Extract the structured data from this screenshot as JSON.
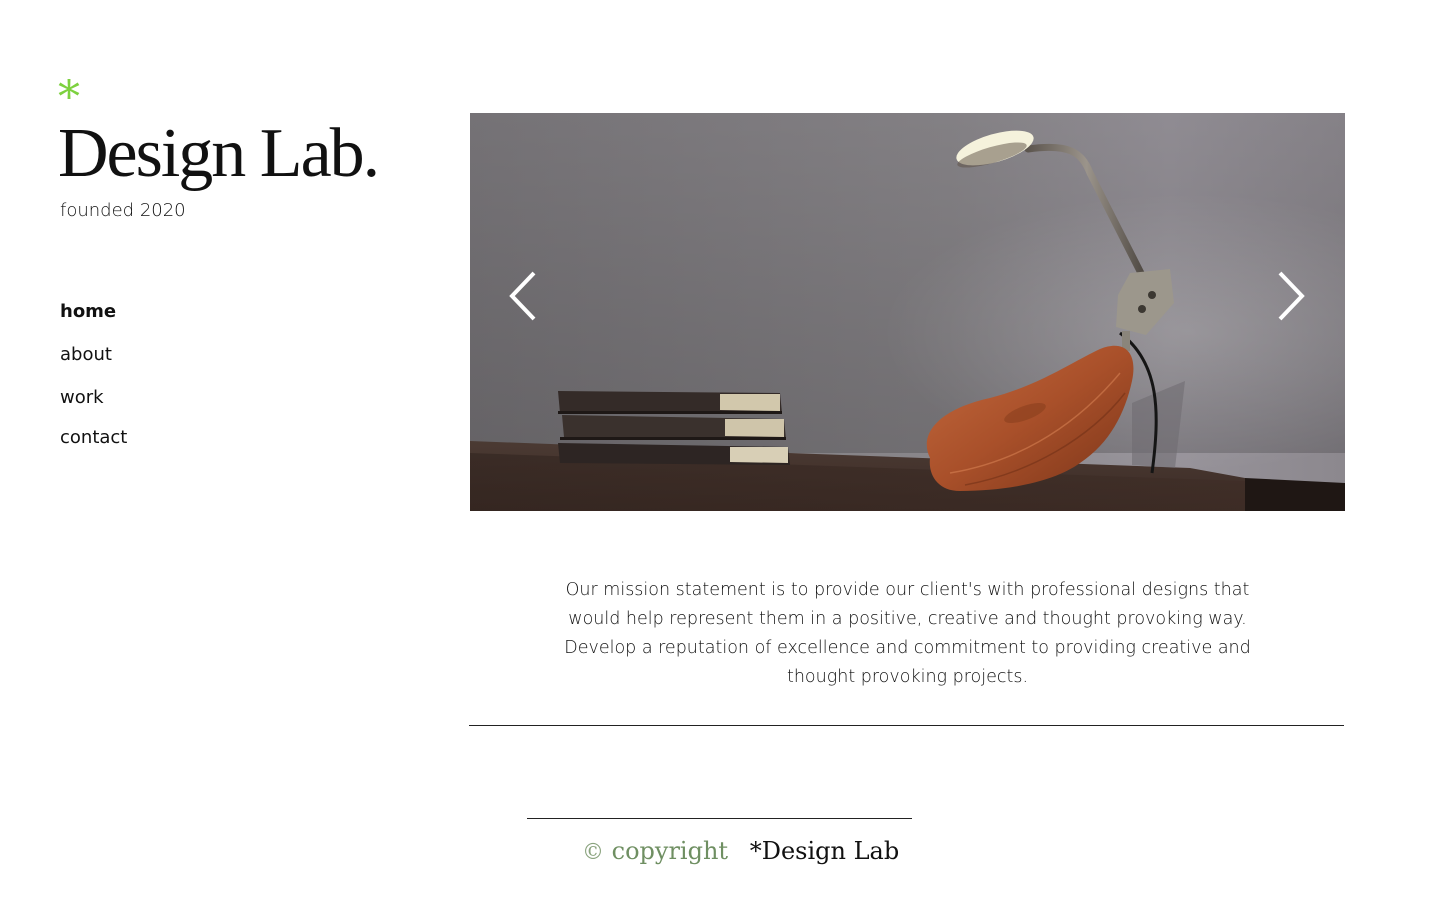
{
  "brand": {
    "asterisk": "*",
    "title": "Design Lab.",
    "subtitle": "founded 2020",
    "accent_color": "#7dd13f"
  },
  "nav": {
    "items": [
      {
        "label": "home",
        "active": true
      },
      {
        "label": "about",
        "active": false
      },
      {
        "label": "work",
        "active": false
      },
      {
        "label": "contact",
        "active": false
      }
    ]
  },
  "carousel": {
    "prev_icon": "chevron-left-icon",
    "next_icon": "chevron-right-icon"
  },
  "mission": {
    "text": "Our mission statement is to provide our client's with professional designs that would help represent them in a positive, creative and thought provoking way. Develop a reputation of excellence and commitment to providing creative and thought provoking projects."
  },
  "footer": {
    "copyright_symbol": "©",
    "copyright_word": "copyright",
    "brand": "*Design Lab",
    "copyright_color": "#6f8f62"
  }
}
